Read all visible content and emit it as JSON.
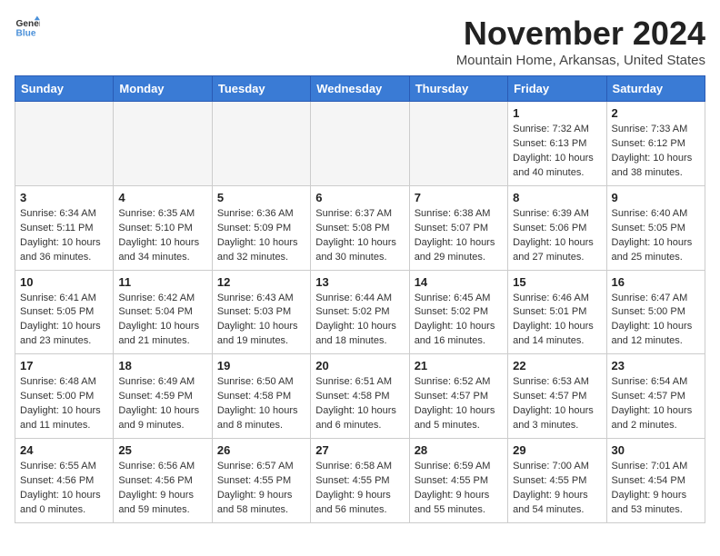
{
  "logo": {
    "general": "General",
    "blue": "Blue"
  },
  "header": {
    "month": "November 2024",
    "location": "Mountain Home, Arkansas, United States"
  },
  "weekdays": [
    "Sunday",
    "Monday",
    "Tuesday",
    "Wednesday",
    "Thursday",
    "Friday",
    "Saturday"
  ],
  "weeks": [
    [
      {
        "day": "",
        "info": ""
      },
      {
        "day": "",
        "info": ""
      },
      {
        "day": "",
        "info": ""
      },
      {
        "day": "",
        "info": ""
      },
      {
        "day": "",
        "info": ""
      },
      {
        "day": "1",
        "info": "Sunrise: 7:32 AM\nSunset: 6:13 PM\nDaylight: 10 hours\nand 40 minutes."
      },
      {
        "day": "2",
        "info": "Sunrise: 7:33 AM\nSunset: 6:12 PM\nDaylight: 10 hours\nand 38 minutes."
      }
    ],
    [
      {
        "day": "3",
        "info": "Sunrise: 6:34 AM\nSunset: 5:11 PM\nDaylight: 10 hours\nand 36 minutes."
      },
      {
        "day": "4",
        "info": "Sunrise: 6:35 AM\nSunset: 5:10 PM\nDaylight: 10 hours\nand 34 minutes."
      },
      {
        "day": "5",
        "info": "Sunrise: 6:36 AM\nSunset: 5:09 PM\nDaylight: 10 hours\nand 32 minutes."
      },
      {
        "day": "6",
        "info": "Sunrise: 6:37 AM\nSunset: 5:08 PM\nDaylight: 10 hours\nand 30 minutes."
      },
      {
        "day": "7",
        "info": "Sunrise: 6:38 AM\nSunset: 5:07 PM\nDaylight: 10 hours\nand 29 minutes."
      },
      {
        "day": "8",
        "info": "Sunrise: 6:39 AM\nSunset: 5:06 PM\nDaylight: 10 hours\nand 27 minutes."
      },
      {
        "day": "9",
        "info": "Sunrise: 6:40 AM\nSunset: 5:05 PM\nDaylight: 10 hours\nand 25 minutes."
      }
    ],
    [
      {
        "day": "10",
        "info": "Sunrise: 6:41 AM\nSunset: 5:05 PM\nDaylight: 10 hours\nand 23 minutes."
      },
      {
        "day": "11",
        "info": "Sunrise: 6:42 AM\nSunset: 5:04 PM\nDaylight: 10 hours\nand 21 minutes."
      },
      {
        "day": "12",
        "info": "Sunrise: 6:43 AM\nSunset: 5:03 PM\nDaylight: 10 hours\nand 19 minutes."
      },
      {
        "day": "13",
        "info": "Sunrise: 6:44 AM\nSunset: 5:02 PM\nDaylight: 10 hours\nand 18 minutes."
      },
      {
        "day": "14",
        "info": "Sunrise: 6:45 AM\nSunset: 5:02 PM\nDaylight: 10 hours\nand 16 minutes."
      },
      {
        "day": "15",
        "info": "Sunrise: 6:46 AM\nSunset: 5:01 PM\nDaylight: 10 hours\nand 14 minutes."
      },
      {
        "day": "16",
        "info": "Sunrise: 6:47 AM\nSunset: 5:00 PM\nDaylight: 10 hours\nand 12 minutes."
      }
    ],
    [
      {
        "day": "17",
        "info": "Sunrise: 6:48 AM\nSunset: 5:00 PM\nDaylight: 10 hours\nand 11 minutes."
      },
      {
        "day": "18",
        "info": "Sunrise: 6:49 AM\nSunset: 4:59 PM\nDaylight: 10 hours\nand 9 minutes."
      },
      {
        "day": "19",
        "info": "Sunrise: 6:50 AM\nSunset: 4:58 PM\nDaylight: 10 hours\nand 8 minutes."
      },
      {
        "day": "20",
        "info": "Sunrise: 6:51 AM\nSunset: 4:58 PM\nDaylight: 10 hours\nand 6 minutes."
      },
      {
        "day": "21",
        "info": "Sunrise: 6:52 AM\nSunset: 4:57 PM\nDaylight: 10 hours\nand 5 minutes."
      },
      {
        "day": "22",
        "info": "Sunrise: 6:53 AM\nSunset: 4:57 PM\nDaylight: 10 hours\nand 3 minutes."
      },
      {
        "day": "23",
        "info": "Sunrise: 6:54 AM\nSunset: 4:57 PM\nDaylight: 10 hours\nand 2 minutes."
      }
    ],
    [
      {
        "day": "24",
        "info": "Sunrise: 6:55 AM\nSunset: 4:56 PM\nDaylight: 10 hours\nand 0 minutes."
      },
      {
        "day": "25",
        "info": "Sunrise: 6:56 AM\nSunset: 4:56 PM\nDaylight: 9 hours\nand 59 minutes."
      },
      {
        "day": "26",
        "info": "Sunrise: 6:57 AM\nSunset: 4:55 PM\nDaylight: 9 hours\nand 58 minutes."
      },
      {
        "day": "27",
        "info": "Sunrise: 6:58 AM\nSunset: 4:55 PM\nDaylight: 9 hours\nand 56 minutes."
      },
      {
        "day": "28",
        "info": "Sunrise: 6:59 AM\nSunset: 4:55 PM\nDaylight: 9 hours\nand 55 minutes."
      },
      {
        "day": "29",
        "info": "Sunrise: 7:00 AM\nSunset: 4:55 PM\nDaylight: 9 hours\nand 54 minutes."
      },
      {
        "day": "30",
        "info": "Sunrise: 7:01 AM\nSunset: 4:54 PM\nDaylight: 9 hours\nand 53 minutes."
      }
    ]
  ]
}
